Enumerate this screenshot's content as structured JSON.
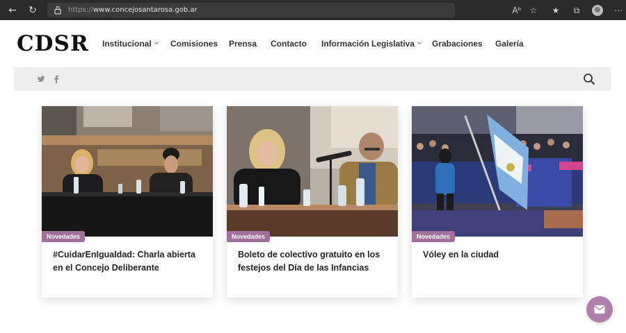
{
  "browser": {
    "url_protocol": "https://",
    "url_domain": "www.concejosantarosa.gob.ar"
  },
  "site": {
    "logo": "CDSR",
    "menu": [
      {
        "label": "Institucional",
        "has_dropdown": true
      },
      {
        "label": "Comisiones",
        "has_dropdown": false
      },
      {
        "label": "Prensa",
        "has_dropdown": false
      },
      {
        "label": "Contacto",
        "has_dropdown": false
      },
      {
        "label": "Información Legislativa",
        "has_dropdown": true
      },
      {
        "label": "Grabaciones",
        "has_dropdown": false
      },
      {
        "label": "Galería",
        "has_dropdown": false
      }
    ],
    "social": [
      {
        "icon": "twitter-icon"
      },
      {
        "icon": "facebook-icon"
      }
    ]
  },
  "cards": [
    {
      "category": "Novedades",
      "title": "#CuidarEnIgualdad: Charla abierta en el Concejo Deliberante",
      "image": "panel-talk-photo"
    },
    {
      "category": "Novedades",
      "title": "Boleto de colectivo gratuito en los festejos del Día de las Infancias",
      "image": "press-conference-photo"
    },
    {
      "category": "Novedades",
      "title": "Vóley en la ciudad",
      "image": "volleyball-event-photo"
    }
  ],
  "colors": {
    "badge": "#a36f9c",
    "fab": "#b07fab",
    "toolbar": "#eeeeee"
  }
}
